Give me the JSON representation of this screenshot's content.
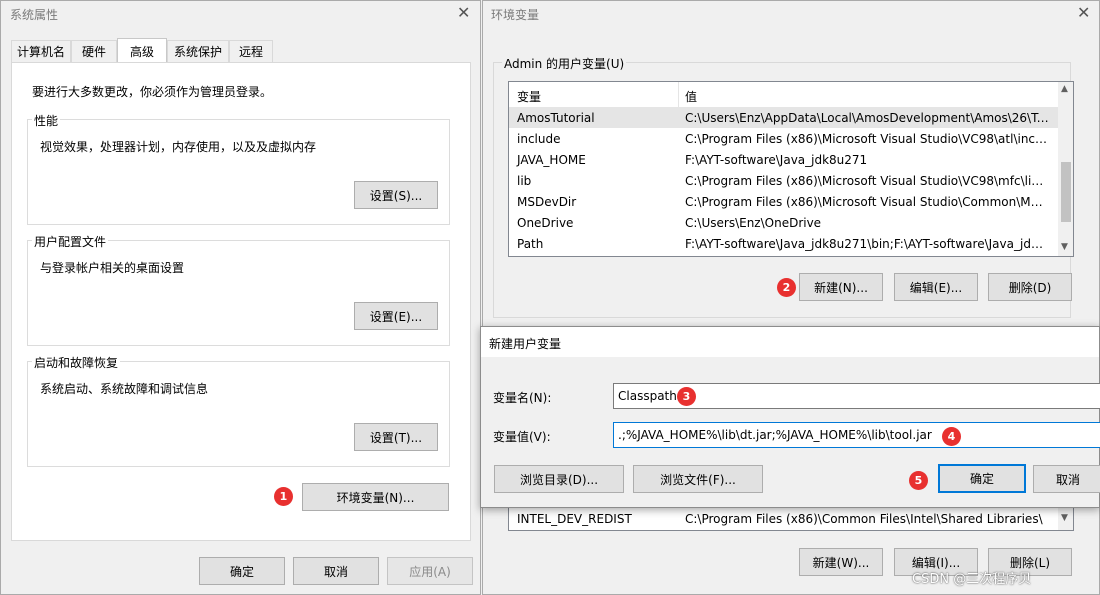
{
  "sys_props": {
    "title": "系统属性",
    "tabs": [
      "计算机名",
      "硬件",
      "高级",
      "系统保护",
      "远程"
    ],
    "admin_note": "要进行大多数更改，你必须作为管理员登录。",
    "performance": {
      "label": "性能",
      "desc": "视觉效果，处理器计划，内存使用，以及及虚拟内存",
      "button": "设置(S)..."
    },
    "profile": {
      "label": "用户配置文件",
      "desc": "与登录帐户相关的桌面设置",
      "button": "设置(E)..."
    },
    "startup": {
      "label": "启动和故障恢复",
      "desc": "系统启动、系统故障和调试信息",
      "button": "设置(T)..."
    },
    "env_button": "环境变量(N)...",
    "ok": "确定",
    "cancel": "取消",
    "apply": "应用(A)"
  },
  "env_vars": {
    "title": "环境变量",
    "user_group_label": "Admin 的用户变量(U)",
    "columns": [
      "变量",
      "值"
    ],
    "user_rows": [
      {
        "name": "AmosTutorial",
        "value": "C:\\Users\\Enz\\AppData\\Local\\AmosDevelopment\\Amos\\26\\Tu..."
      },
      {
        "name": "include",
        "value": "C:\\Program Files (x86)\\Microsoft Visual Studio\\VC98\\atl\\inclu..."
      },
      {
        "name": "JAVA_HOME",
        "value": "F:\\AYT-software\\Java_jdk8u271"
      },
      {
        "name": "lib",
        "value": "C:\\Program Files (x86)\\Microsoft Visual Studio\\VC98\\mfc\\lib;..."
      },
      {
        "name": "MSDevDir",
        "value": "C:\\Program Files (x86)\\Microsoft Visual Studio\\Common\\MS..."
      },
      {
        "name": "OneDrive",
        "value": "C:\\Users\\Enz\\OneDrive"
      },
      {
        "name": "Path",
        "value": "F:\\AYT-software\\Java_jdk8u271\\bin;F:\\AYT-software\\Java_jdk8..."
      }
    ],
    "user_new": "新建(N)...",
    "user_edit": "编辑(E)...",
    "user_delete": "删除(D)",
    "system_row": {
      "name": "INTEL_DEV_REDIST",
      "value": "C:\\Program Files (x86)\\Common Files\\Intel\\Shared Libraries\\"
    },
    "sys_new": "新建(W)...",
    "sys_edit": "编辑(I)...",
    "sys_delete": "删除(L)"
  },
  "new_var": {
    "title": "新建用户变量",
    "name_label": "变量名(N):",
    "name_value": "Classpath",
    "value_label": "变量值(V):",
    "value_value": ".;%JAVA_HOME%\\lib\\dt.jar;%JAVA_HOME%\\lib\\tool.jar",
    "browse_dir": "浏览目录(D)...",
    "browse_file": "浏览文件(F)...",
    "ok": "确定",
    "cancel": "取消"
  },
  "badges": [
    "1",
    "2",
    "3",
    "4",
    "5"
  ],
  "watermark": "CSDN @三次程序贝",
  "colors": {
    "badge": "#e8302f",
    "focus": "#0078d7",
    "selected_row": "#e5e5e5"
  }
}
